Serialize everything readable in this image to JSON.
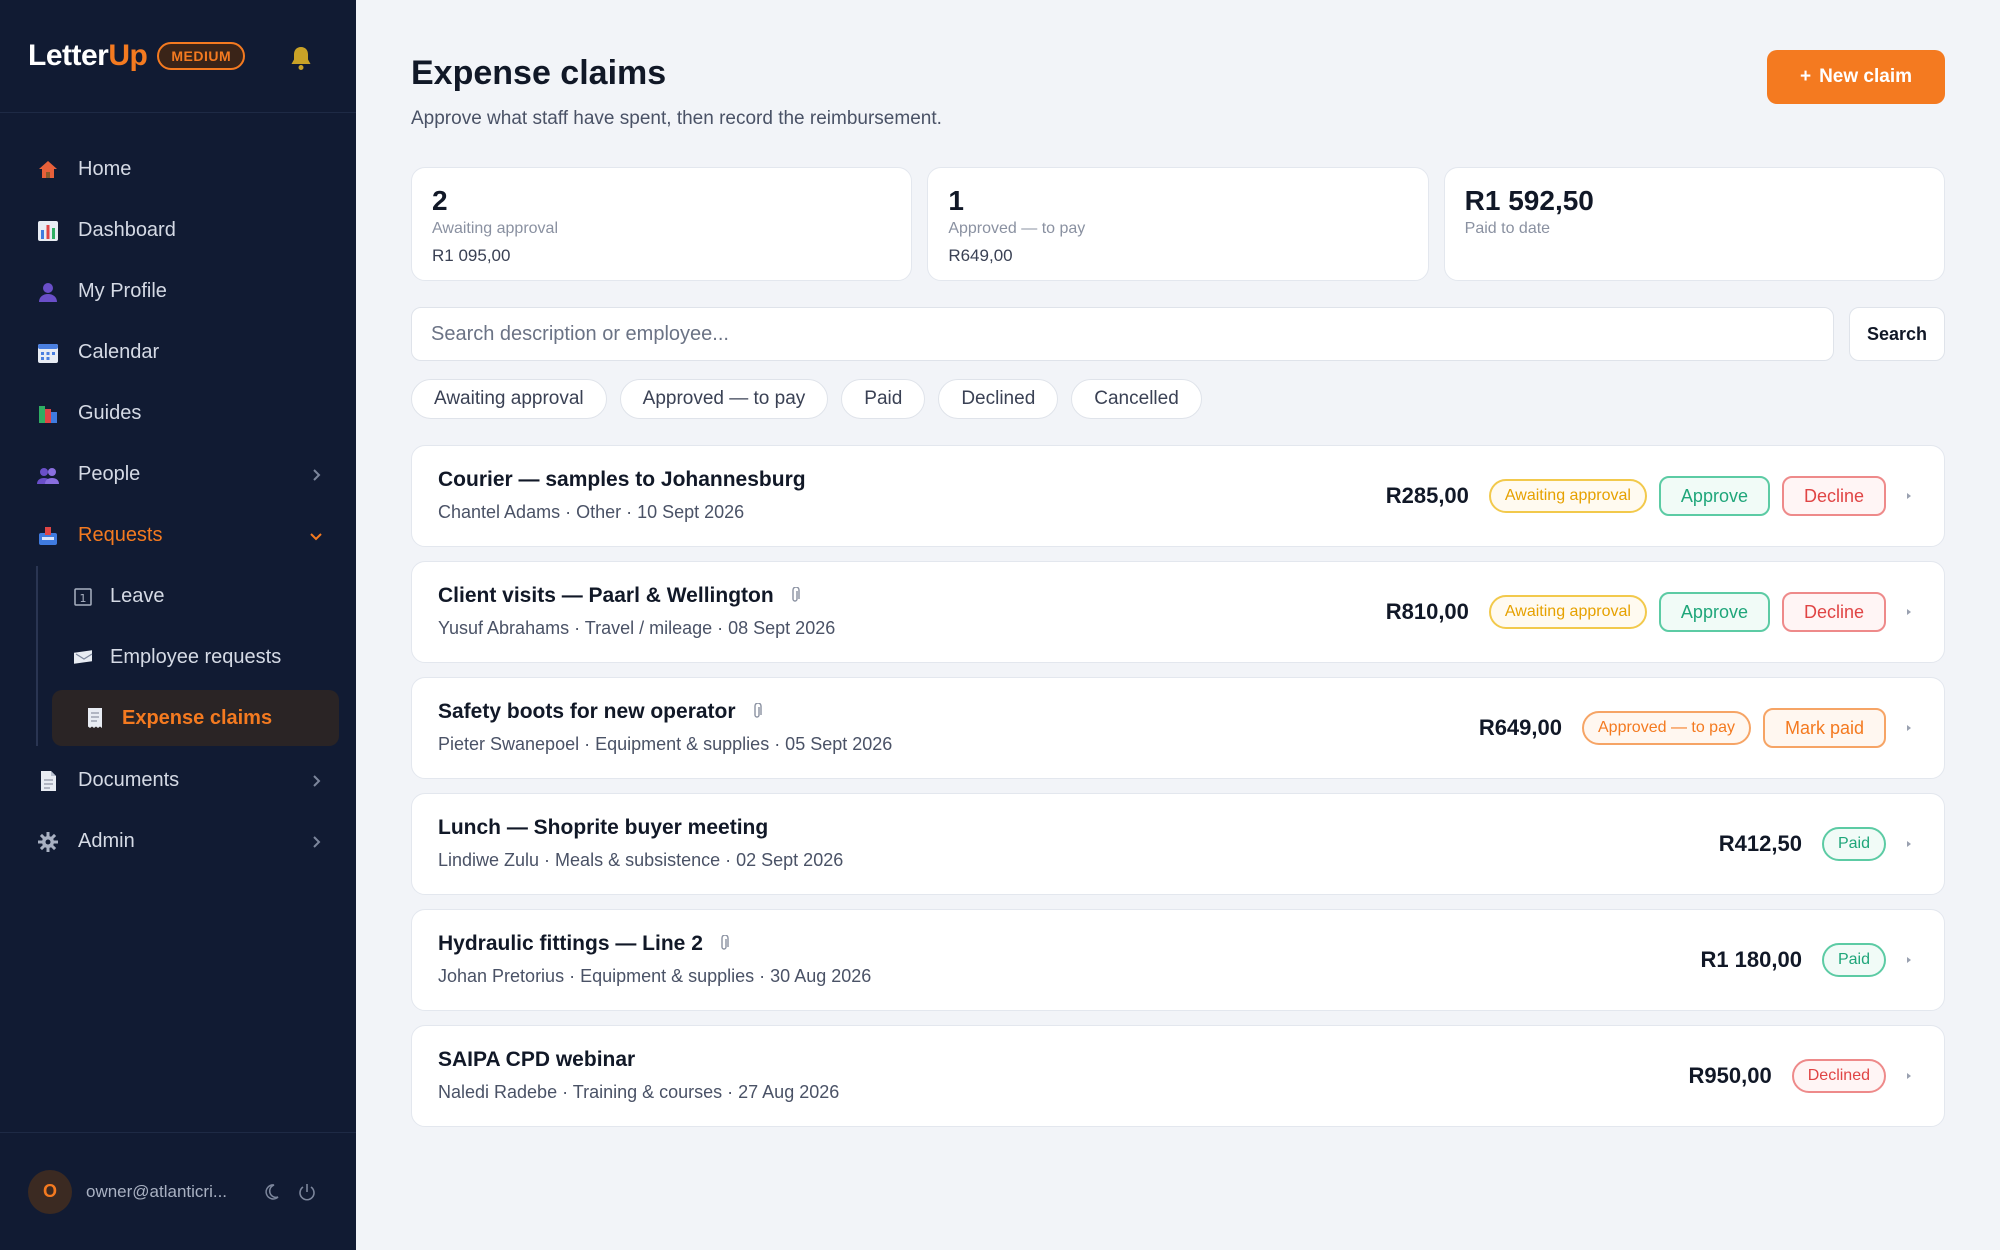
{
  "brand": {
    "name_part1": "Letter",
    "name_part2": "Up",
    "plan": "MEDIUM"
  },
  "sidebar": {
    "items": [
      {
        "label": "Home",
        "icon": "home-icon"
      },
      {
        "label": "Dashboard",
        "icon": "bar-chart-icon"
      },
      {
        "label": "My Profile",
        "icon": "user-icon"
      },
      {
        "label": "Calendar",
        "icon": "calendar-icon"
      },
      {
        "label": "Guides",
        "icon": "books-icon"
      },
      {
        "label": "People",
        "icon": "people-icon"
      },
      {
        "label": "Requests",
        "icon": "inbox-icon"
      },
      {
        "label": "Documents",
        "icon": "document-icon"
      },
      {
        "label": "Admin",
        "icon": "gear-icon"
      }
    ],
    "sub_items": [
      {
        "label": "Leave",
        "icon": "calendar-day-icon"
      },
      {
        "label": "Employee requests",
        "icon": "envelope-icon"
      },
      {
        "label": "Expense claims",
        "icon": "receipt-icon"
      }
    ],
    "user_email": "owner@atlanticri...",
    "avatar_initial": "O"
  },
  "page": {
    "title": "Expense claims",
    "subtitle": "Approve what staff have spent, then record the reimbursement.",
    "new_claim_label": "New claim"
  },
  "stats": [
    {
      "value": "2",
      "label": "Awaiting approval",
      "amount": "R1 095,00"
    },
    {
      "value": "1",
      "label": "Approved — to pay",
      "amount": "R649,00"
    },
    {
      "value": "R1 592,50",
      "label": "Paid to date",
      "amount": ""
    }
  ],
  "search": {
    "placeholder": "Search description or employee...",
    "button_label": "Search"
  },
  "filters": [
    "Awaiting approval",
    "Approved — to pay",
    "Paid",
    "Declined",
    "Cancelled"
  ],
  "actions": {
    "approve": "Approve",
    "decline": "Decline",
    "mark_paid": "Mark paid"
  },
  "claims": [
    {
      "title": "Courier — samples to Johannesburg",
      "meta": "Chantel Adams · Other · 10 Sept 2026",
      "amount": "R285,00",
      "status": "Awaiting approval"
    },
    {
      "title": "Client visits — Paarl & Wellington",
      "meta": "Yusuf Abrahams · Travel / mileage · 08 Sept 2026",
      "amount": "R810,00",
      "status": "Awaiting approval"
    },
    {
      "title": "Safety boots for new operator",
      "meta": "Pieter Swanepoel · Equipment & supplies · 05 Sept 2026",
      "amount": "R649,00",
      "status": "Approved — to pay"
    },
    {
      "title": "Lunch — Shoprite buyer meeting",
      "meta": "Lindiwe Zulu · Meals & subsistence · 02 Sept 2026",
      "amount": "R412,50",
      "status": "Paid"
    },
    {
      "title": "Hydraulic fittings — Line 2",
      "meta": "Johan Pretorius · Equipment & supplies · 30 Aug 2026",
      "amount": "R1 180,00",
      "status": "Paid"
    },
    {
      "title": "SAIPA CPD webinar",
      "meta": "Naledi Radebe · Training & courses · 27 Aug 2026",
      "amount": "R950,00",
      "status": "Declined"
    }
  ],
  "colors": {
    "accent": "#f47a20",
    "sidebar_bg": "#111b33",
    "page_bg": "#f2f4f8",
    "paid": "#1fa67a",
    "declined": "#e04545",
    "awaiting": "#e6a100"
  }
}
